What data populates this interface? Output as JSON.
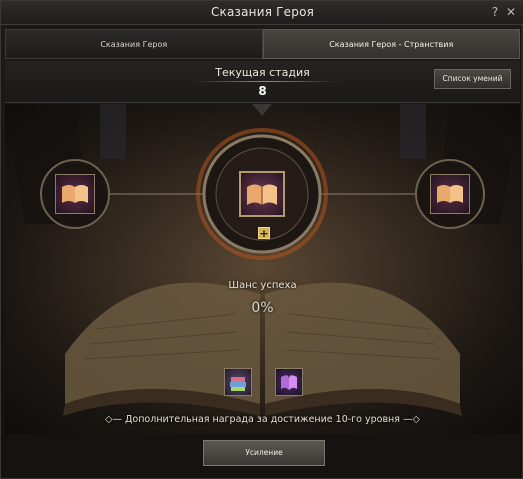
{
  "window": {
    "title": "Сказания Героя",
    "help_icon": "question-icon",
    "close_icon": "close-icon"
  },
  "tabs": [
    {
      "label": "Сказания Героя",
      "active": false
    },
    {
      "label": "Сказания Героя - Странствия",
      "active": true
    }
  ],
  "stage": {
    "label": "Текущая стадия",
    "value": "8",
    "skills_button": "Список умений"
  },
  "scene": {
    "center_item_icon": "open-book-icon",
    "left_item_icon": "open-book-icon",
    "right_item_icon": "open-book-icon",
    "plus_label": "+",
    "chance_label": "Шанс успеха",
    "chance_value": "0%",
    "reward_items": [
      "book-stack-icon",
      "purple-tome-icon"
    ],
    "reward_text": "Дополнительная награда за достижение 10-го уровня"
  },
  "footer": {
    "enhance_button": "Усиление"
  },
  "colors": {
    "accent_gold": "#d5b456",
    "frame": "#b09a74",
    "background": "#121110"
  }
}
